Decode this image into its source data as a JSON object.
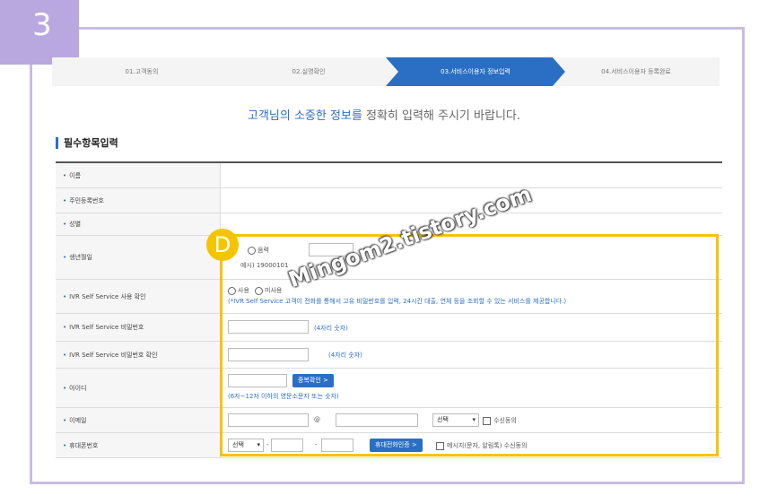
{
  "step_badge": "3",
  "steps": [
    {
      "label": "01.고객동의"
    },
    {
      "label": "02.실명확인"
    },
    {
      "label": "03.서비스이용자 정보입력"
    },
    {
      "label": "04.서비스이용자 등록완료"
    }
  ],
  "headline": {
    "part1": "고객님의 소중한 정보를",
    "part2": " 정확히 입력해 주시기 바랍니다."
  },
  "section_title": "필수항목입력",
  "fields": {
    "name": "이름",
    "rrn": "주민등록번호",
    "gender": "성별",
    "birth": {
      "label": "생년월일",
      "radio1": "음력",
      "radio0": "",
      "example": "예시) 19000101"
    },
    "ivr_use": {
      "label": "IVR Self Service 사용 확인",
      "opt1": "사용",
      "opt2": "미사용",
      "note": "(*IVR Self Service 고객이 전화를 통해서 고유 비밀번호를 입력, 24시간 대출, 연체 등을 조회할 수 있는 서비스를 제공합니다.)"
    },
    "ivr_pw": {
      "label": "IVR Self Service 비밀번호",
      "hint": "(4자리 숫자)"
    },
    "ivr_pw_confirm": {
      "label": "IVR Self Service 비밀번호 확인",
      "hint": "(4자리 숫자)"
    },
    "userid": {
      "label": "아이디",
      "button": "중복확인 >",
      "hint": "(6자~12자 이하의 영문소문자 또는 숫자)"
    },
    "email": {
      "label": "이메일",
      "at": "@",
      "select": "선택",
      "consent": "수신동의"
    },
    "phone": {
      "label": "휴대폰번호",
      "select": "선택",
      "dash": "-",
      "button": "휴대전화인증 >",
      "consent": "메시지(문자, 알림톡) 수신동의"
    }
  },
  "highlight_badge": "D",
  "watermark": "Mingom2.tistory.com",
  "colors": {
    "accent": "#2a6fc3",
    "highlight": "#f5c400",
    "badge": "#b9a8df",
    "frame": "#c8bde0"
  }
}
